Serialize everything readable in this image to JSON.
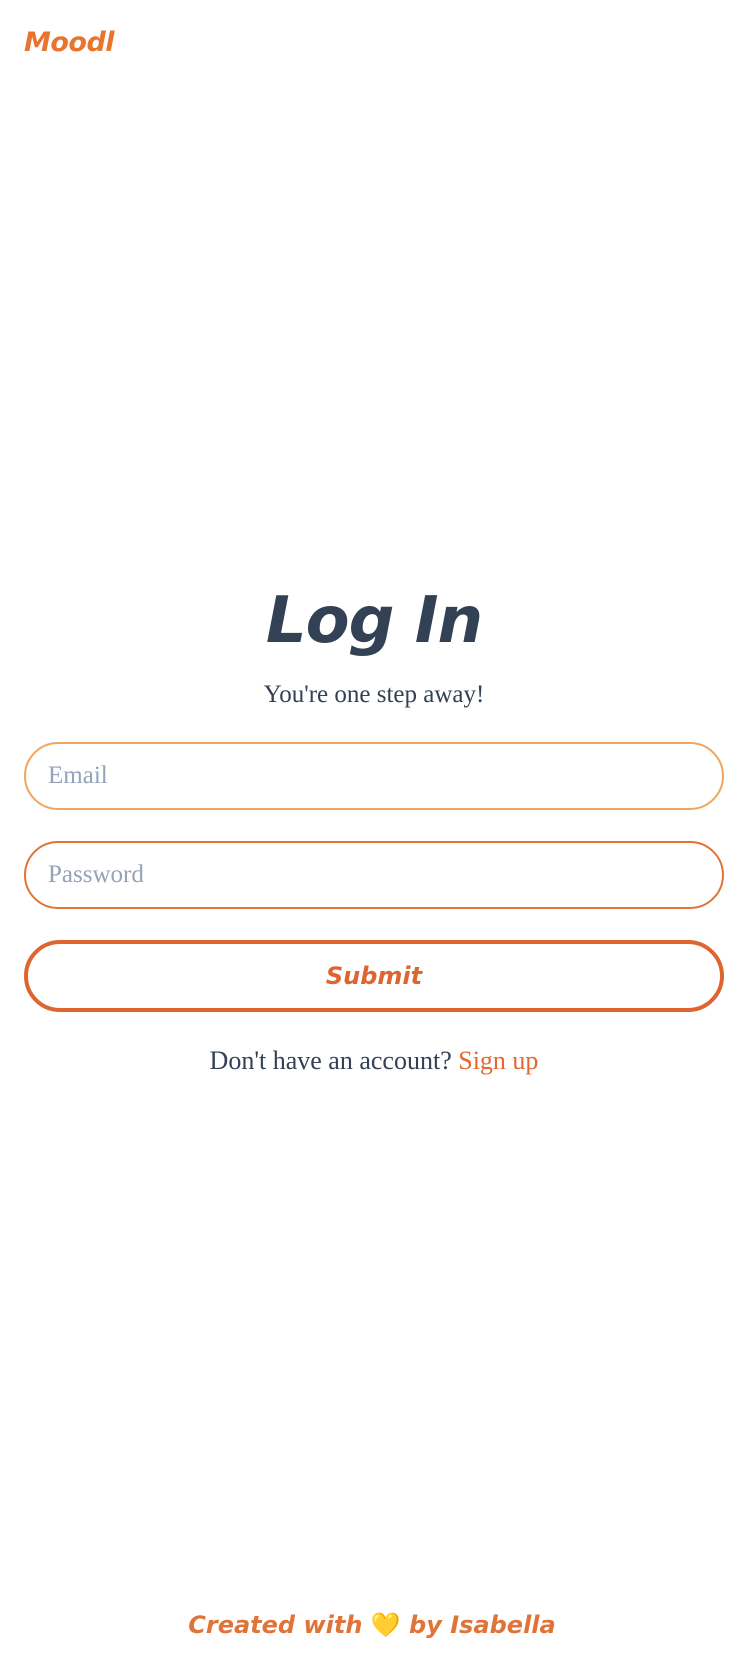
{
  "brand": {
    "name": "Moodl"
  },
  "login": {
    "title": "Log In",
    "subtitle": "You're one step away!",
    "email_placeholder": "Email",
    "email_value": "",
    "password_placeholder": "Password",
    "password_value": "",
    "submit_label": "Submit",
    "signup_prompt": "Don't have an account? ",
    "signup_link": "Sign up"
  },
  "footer": {
    "prefix": "Created with ",
    "heart": "💛",
    "suffix": " by Isabella"
  },
  "colors": {
    "accent": "#e8742e",
    "text": "#334155",
    "placeholder": "#94a3b8",
    "heart": "#f5c544"
  },
  "icons": {
    "heart": "heart-icon"
  }
}
